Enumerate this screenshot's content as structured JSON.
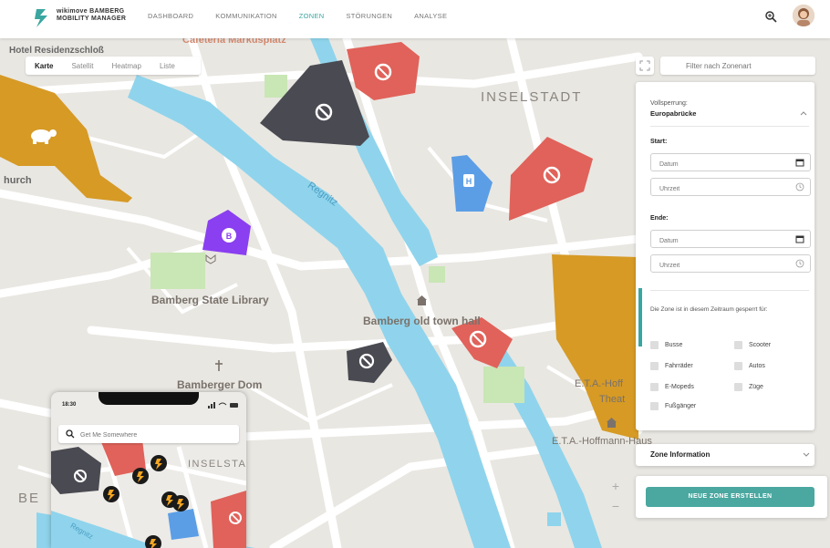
{
  "brand": {
    "line1": "wikimove BAMBERG",
    "line2": "MOBILITY MANAGER"
  },
  "nav": [
    {
      "label": "DASHBOARD"
    },
    {
      "label": "KOMMUNIKATION"
    },
    {
      "label": "ZONEN",
      "active": true
    },
    {
      "label": "STÖRUNGEN"
    },
    {
      "label": "ANALYSE"
    }
  ],
  "colors": {
    "accent": "#3aa6a0",
    "red_zone": "#e0625a",
    "dark_zone": "#4a4a52",
    "blue_zone": "#5b9ee6",
    "purple_zone": "#8a3ff0",
    "orange_zone": "#d69a25",
    "water": "#8fd4ec"
  },
  "map_labels": {
    "hotel": "Hotel Residenzschloß",
    "cafeteria": "Cafeteria Markusplatz",
    "inselstadt": "INSELSTADT",
    "regnitz": "Regnitz",
    "church": "hurch",
    "library": "Bamberg State Library",
    "town_hall": "Bamberg old town hall",
    "dom": "Bamberger Dom",
    "eta": "E.T.A.-Hoff",
    "theat": "Theat",
    "eta2": "E.T.A.-Hoffmann-Haus",
    "be": "BE"
  },
  "map_types": [
    "Karte",
    "Satellit",
    "Heatmap",
    "Liste"
  ],
  "filter": {
    "placeholder": "Filter nach Zonenart"
  },
  "panel": {
    "title_label": "Vollsperrung:",
    "title_value": "Europabrücke",
    "start_label": "Start:",
    "end_label": "Ende:",
    "date_placeholder": "Datum",
    "time_placeholder": "Uhrzeit",
    "blocked_for": "Die Zone ist in diesem Zeitraum gesperrt für:",
    "checkboxes": [
      "Busse",
      "Scooter",
      "Fahrräder",
      "Autos",
      "E-Mopeds",
      "Züge",
      "Fußgänger"
    ]
  },
  "zone_info": {
    "label": "Zone Information"
  },
  "create_button": "NEUE ZONE ERSTELLEN",
  "zoom": {
    "plus": "+",
    "minus": "−"
  },
  "phone": {
    "time": "18:30",
    "search_placeholder": "Get Me Somewhere",
    "label_inselstadt": "INSELSTA",
    "label_regnitz": "Regnitz"
  }
}
